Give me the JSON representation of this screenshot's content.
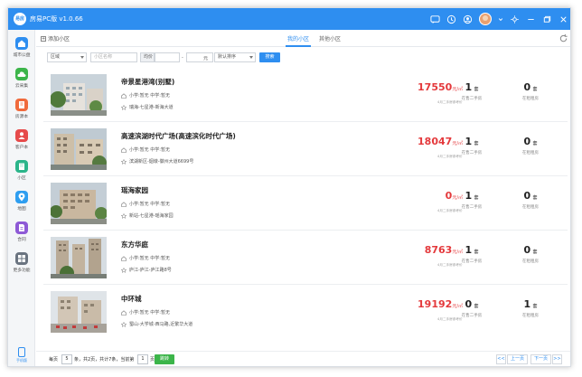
{
  "app": {
    "logo_text": "易房",
    "title": "房易PC版 v1.0.66"
  },
  "titlebar_icons": [
    "message-icon",
    "bell-icon",
    "user-circle-icon",
    "avatar",
    "chevron-down-icon",
    "settings-icon",
    "minimize-icon",
    "restore-icon",
    "close-icon"
  ],
  "sidebar": {
    "items": [
      {
        "id": "home",
        "label": "城市公盘",
        "color": "#2e8ef0",
        "icon": "home-icon"
      },
      {
        "id": "cloud",
        "label": "云采集",
        "color": "#3cb54a",
        "icon": "cloud-icon"
      },
      {
        "id": "listing",
        "label": "房源本",
        "color": "#f06a3c",
        "icon": "book-icon"
      },
      {
        "id": "customer",
        "label": "客户本",
        "color": "#e64b4b",
        "icon": "user-icon"
      },
      {
        "id": "community",
        "label": "小区",
        "color": "#2bb58a",
        "icon": "building-icon"
      },
      {
        "id": "map",
        "label": "地图",
        "color": "#2e9ef0",
        "icon": "map-pin-icon"
      },
      {
        "id": "contract",
        "label": "合同",
        "color": "#8e5ad6",
        "icon": "document-icon"
      },
      {
        "id": "more",
        "label": "更多功能",
        "color": "#6a7480",
        "icon": "grid-icon"
      }
    ],
    "phone_label": "手机版"
  },
  "toolbar": {
    "add_label": "添加小区",
    "tabs": [
      {
        "label": "我的小区",
        "active": true
      },
      {
        "label": "其他小区",
        "active": false
      }
    ]
  },
  "filter": {
    "district": "区域",
    "name_placeholder": "小区名称",
    "price_type": "均价",
    "dash": "-",
    "unit": "元",
    "sort": "默认排序",
    "search_label": "搜索"
  },
  "labels": {
    "price_unit": "元/㎡",
    "price_caption": "4月二手房参考价",
    "count_unit": "套",
    "sale_caption": "在售二手房",
    "rent_caption": "在租租房"
  },
  "communities": [
    {
      "name": "帝景星港湾(别墅)",
      "schools": "小学:暂无  中学:暂无",
      "address": "瑞海-七星港-新海大道",
      "price": "17550",
      "on_sale": "1",
      "for_rent": "0"
    },
    {
      "name": "高速滨湖时代广场(高速滨化时代广场)",
      "schools": "小学:暂无  中学:暂无",
      "address": "滨湖新区-烟墩-徽州大道6699号",
      "price": "18047",
      "on_sale": "1",
      "for_rent": "0"
    },
    {
      "name": "瑶海家园",
      "schools": "小学:暂无  中学:暂无",
      "address": "新站-七星港-瑶海家园",
      "price": "0",
      "on_sale": "1",
      "for_rent": "0"
    },
    {
      "name": "东方华庭",
      "schools": "小学:暂无  中学:暂无",
      "address": "庐江-庐江-庐江路8号",
      "price": "8763",
      "on_sale": "1",
      "for_rent": "0"
    },
    {
      "name": "中环城",
      "schools": "小学:暂无  中学:暂无",
      "address": "蜀山-大学城-西马路,近繁华大道",
      "price": "19192",
      "on_sale": "0",
      "for_rent": "1"
    }
  ],
  "pagination": {
    "per_page_prefix": "每页",
    "per_page": "5",
    "summary": "条，共2页，共计7条，当前第",
    "current": "1",
    "page_suffix": "页",
    "jump_label": "跳转",
    "first": "<<",
    "prev": "上一页",
    "next": "下一页",
    "last": ">>"
  }
}
